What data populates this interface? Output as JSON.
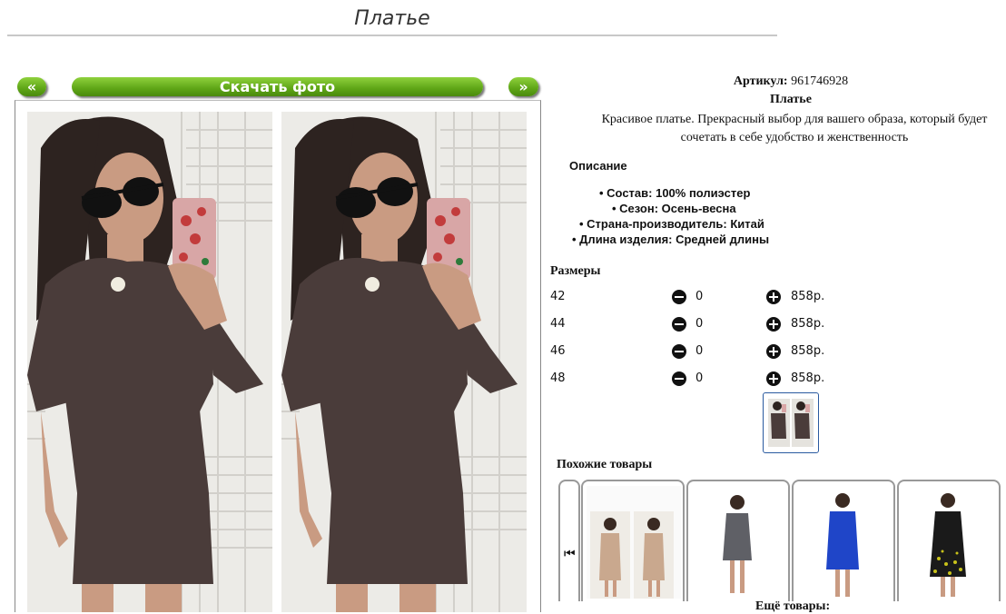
{
  "page": {
    "title": "Платье"
  },
  "gallery": {
    "prev_label": "«",
    "download_label": "Скачать фото",
    "next_label": "»"
  },
  "product": {
    "article_label": "Артикул:",
    "article_value": "961746928",
    "name": "Платье",
    "description_line1": "Красивое платье. Прекрасный выбор для вашего образа, который будет",
    "description_line2": "сочетать в себе удобство и женственность",
    "description_heading": "Описание",
    "specs": [
      "Состав: 100% полиэстер",
      "Сезон: Осень-весна",
      "Страна-производитель: Китай",
      "Длина изделия: Средней длины"
    ]
  },
  "sizes": {
    "heading": "Размеры",
    "rows": [
      {
        "size": "42",
        "qty": "0",
        "price": "858р."
      },
      {
        "size": "44",
        "qty": "0",
        "price": "858р."
      },
      {
        "size": "46",
        "qty": "0",
        "price": "858р."
      },
      {
        "size": "48",
        "qty": "0",
        "price": "858р."
      }
    ]
  },
  "similar": {
    "heading": "Похожие товары",
    "more_label": "Ещё товары:",
    "prev_icon": "skip-back-icon",
    "items": [
      {
        "dress_color": "#c9a88e"
      },
      {
        "dress_color": "#5f6066"
      },
      {
        "dress_color": "#1f45c8"
      },
      {
        "dress_color": "#1a1a1a",
        "pattern_color": "#c8c21a"
      }
    ]
  },
  "colors": {
    "accent_green": "#5ea516",
    "dress_main": "#4a3c3a",
    "thumb_border": "#2a5aa0"
  }
}
